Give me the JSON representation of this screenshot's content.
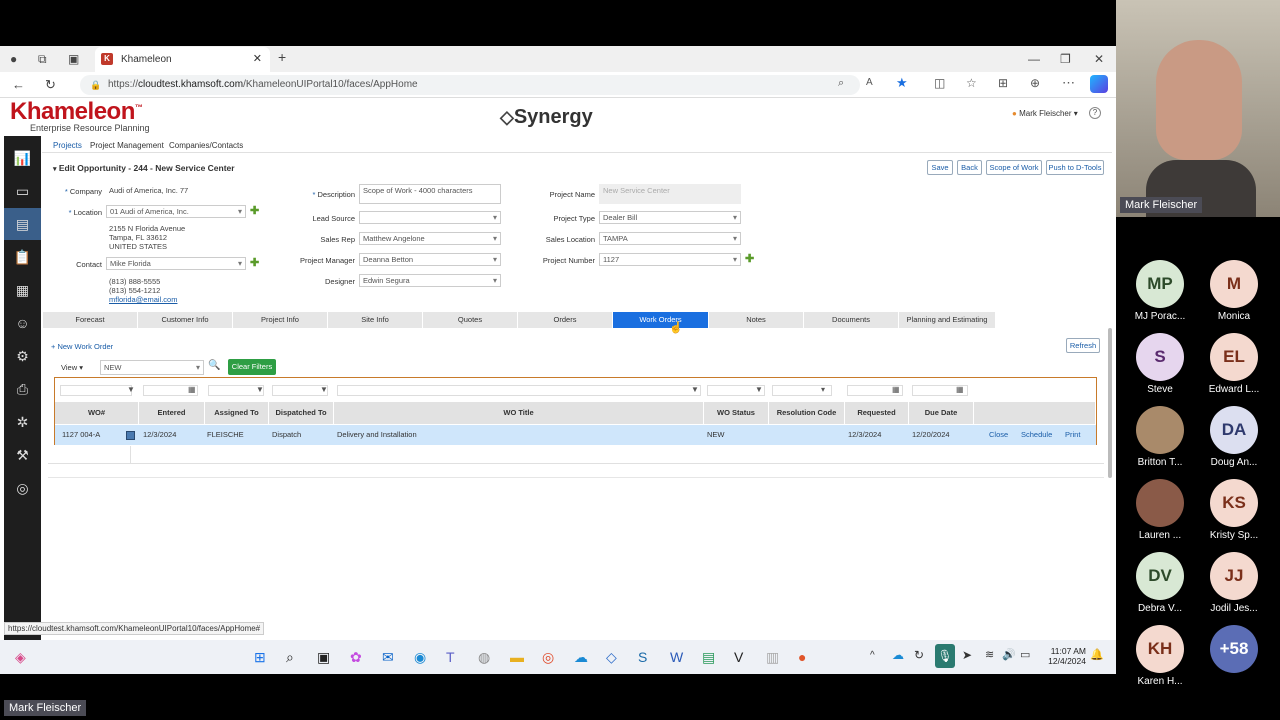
{
  "browser": {
    "tab_title": "Khameleon",
    "url_scheme": "https://",
    "url_host": "cloudtest.khamsoft.com",
    "url_path": "/KhameleonUIPortal10/faces/AppHome",
    "status_url": "https://cloudtest.khamsoft.com/KhameleonUIPortal10/faces/AppHome#"
  },
  "app": {
    "logo_main": "Khameleon",
    "logo_tm": "™",
    "logo_sub": "Enterprise Resource Planning",
    "brand": "Synergy",
    "user": "Mark Fleischer ▾",
    "help": "?"
  },
  "submenu": [
    "Projects",
    "Project Management",
    "Companies/Contacts"
  ],
  "page_title": "Edit Opportunity - 244 - New Service Center",
  "header_buttons": [
    "Save",
    "Back",
    "Scope of Work",
    "Push to D-Tools"
  ],
  "form": {
    "company_label": "Company",
    "company_value": "Audi of America, Inc. 77",
    "location_label": "Location",
    "location_value": "01  Audi of America, Inc.",
    "address1": "2155 N Florida Avenue",
    "address2": "Tampa, FL 33612",
    "address3": "UNITED STATES",
    "contact_label": "Contact",
    "contact_value": "Mike Florida",
    "phone1": "(813) 888-5555",
    "phone2": "(813) 554-1212",
    "email": "mflorida@email.com",
    "description_label": "Description",
    "description_value": "Scope of Work - 4000 characters",
    "lead_source_label": "Lead Source",
    "lead_source_value": "",
    "sales_rep_label": "Sales Rep",
    "sales_rep_value": "Matthew Angelone",
    "project_manager_label": "Project Manager",
    "project_manager_value": "Deanna Betton",
    "designer_label": "Designer",
    "designer_value": "Edwin Segura",
    "project_name_label": "Project Name",
    "project_name_value": "New Service Center",
    "project_type_label": "Project Type",
    "project_type_value": "Dealer Bill",
    "sales_location_label": "Sales Location",
    "sales_location_value": "TAMPA",
    "project_number_label": "Project Number",
    "project_number_value": "1127"
  },
  "tabs": [
    "Forecast",
    "Customer Info",
    "Project Info",
    "Site Info",
    "Quotes",
    "Orders",
    "Work Orders",
    "Notes",
    "Documents",
    "Planning and Estimating"
  ],
  "active_tab": "Work Orders",
  "work_orders": {
    "new_link": "+ New Work Order",
    "refresh": "Refresh",
    "view_label": "View ▾",
    "view_filter": "NEW",
    "clear_filters": "Clear Filters",
    "columns": [
      "WO#",
      "Entered",
      "Assigned To",
      "Dispatched To",
      "WO Title",
      "WO Status",
      "Resolution Code",
      "Requested",
      "Due Date"
    ],
    "rows": [
      {
        "wo": "1127 004-A",
        "entered": "12/3/2024",
        "assigned": "FLEISCHE",
        "dispatched": "Dispatch",
        "title": "Delivery and Installation",
        "status": "NEW",
        "resolution": "",
        "requested": "12/3/2024",
        "due": "12/20/2024",
        "actions": [
          "Close",
          "Schedule",
          "Print"
        ]
      }
    ]
  },
  "taskbar": {
    "time": "11:07 AM",
    "date": "12/4/2024"
  },
  "meeting": {
    "presenter": "Mark Fleischer",
    "bottom_label": "Mark Fleischer",
    "participants": [
      {
        "initials": "MP",
        "name": "MJ Porac...",
        "bg": "#d8e8d4",
        "fg": "#2d4a2a"
      },
      {
        "initials": "M",
        "name": "Monica",
        "bg": "#f4d9cf",
        "fg": "#7a2f1a"
      },
      {
        "initials": "S",
        "name": "Steve",
        "bg": "#e6d6ee",
        "fg": "#5a2a6e"
      },
      {
        "initials": "EL",
        "name": "Edward L...",
        "bg": "#f4d9cf",
        "fg": "#7a2f1a"
      },
      {
        "initials": "",
        "name": "Britton T...",
        "bg": "#a98a6a",
        "fg": "#fff"
      },
      {
        "initials": "DA",
        "name": "Doug An...",
        "bg": "#dcdff0",
        "fg": "#2f3a6e"
      },
      {
        "initials": "",
        "name": "Lauren ...",
        "bg": "#8a5a48",
        "fg": "#fff"
      },
      {
        "initials": "KS",
        "name": "Kristy Sp...",
        "bg": "#f4d9cf",
        "fg": "#7a2f1a"
      },
      {
        "initials": "DV",
        "name": "Debra V...",
        "bg": "#d8e8d4",
        "fg": "#2d4a2a"
      },
      {
        "initials": "JJ",
        "name": "Jodil Jes...",
        "bg": "#f4d9cf",
        "fg": "#7a2f1a"
      },
      {
        "initials": "KH",
        "name": "Karen H...",
        "bg": "#f4d9cf",
        "fg": "#7a2f1a"
      },
      {
        "initials": "+58",
        "name": "",
        "bg": "#5b6db5",
        "fg": "#fff"
      }
    ]
  }
}
